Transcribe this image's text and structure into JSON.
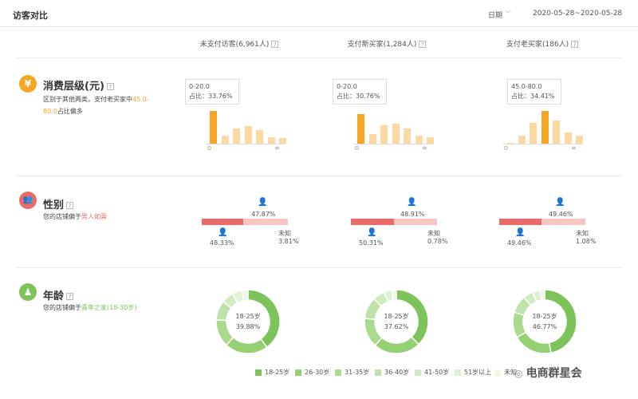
{
  "header": {
    "title": "访客对比",
    "date_label": "日期",
    "date_range": "2020-05-28~2020-05-28"
  },
  "columns": [
    {
      "label": "未支付访客(6,961人)"
    },
    {
      "label": "支付新买家(1,284人)"
    },
    {
      "label": "支付老买家(186人)"
    }
  ],
  "help_icon_text": "?",
  "sections": {
    "spend": {
      "icon": "¥",
      "title": "消费层级(元)",
      "desc_prefix": "区别于其他两类，支付老买家中",
      "desc_highlight_a": "45.0",
      "desc_highlight_b": "80.0",
      "desc_suffix": "占比偏多",
      "color_active": "#f5a623",
      "color_light": "#fbd9a0"
    },
    "gender": {
      "icon": "👥",
      "title": "性别",
      "desc_prefix": "您的店铺偏于",
      "desc_highlight": "男人如膏",
      "unknown_label": "未知"
    },
    "age": {
      "icon": "♟",
      "title": "年龄",
      "desc_prefix": "您的店铺偏于",
      "desc_highlight": "青年之家(18-30岁)"
    }
  },
  "spend_charts": [
    {
      "tooltip_range": "0-20.0",
      "tooltip_share": "占比：33.76%",
      "values": [
        33.76,
        8,
        16,
        18,
        14,
        7,
        6
      ],
      "highlight": 0
    },
    {
      "tooltip_range": "0-20.0",
      "tooltip_share": "占比：30.76%",
      "values": [
        30.76,
        10,
        19,
        21,
        16,
        8,
        7
      ],
      "highlight": 0
    },
    {
      "tooltip_range": "45.0-80.0",
      "tooltip_share": "占比：34.41%",
      "values": [
        1,
        8,
        22,
        34.41,
        24,
        12,
        8
      ],
      "highlight": 3
    }
  ],
  "gender": [
    {
      "female_pct": "47.87%",
      "male_pct": "48.33%",
      "unknown_pct": "3.81%",
      "male": 48.33,
      "female": 47.87
    },
    {
      "female_pct": "48.91%",
      "male_pct": "50.31%",
      "unknown_pct": "0.78%",
      "male": 50.31,
      "female": 48.91
    },
    {
      "female_pct": "49.46%",
      "male_pct": "49.46%",
      "unknown_pct": "1.08%",
      "male": 49.46,
      "female": 49.46
    }
  ],
  "age": [
    {
      "center_label": "18-25岁",
      "center_value": "39.88%",
      "values": [
        39.88,
        22,
        14,
        10,
        6,
        5,
        3.12
      ]
    },
    {
      "center_label": "18-25岁",
      "center_value": "37.62%",
      "values": [
        37.62,
        24,
        15,
        11,
        6,
        4,
        2.38
      ]
    },
    {
      "center_label": "18-25岁",
      "center_value": "46.77%",
      "values": [
        46.77,
        20,
        13,
        9,
        5,
        4,
        2.23
      ]
    }
  ],
  "age_legend": [
    {
      "label": "18-25岁",
      "color": "#7cc45a"
    },
    {
      "label": "26-30岁",
      "color": "#93d072"
    },
    {
      "label": "31-35岁",
      "color": "#a9da8e"
    },
    {
      "label": "36-40岁",
      "color": "#bde3a8"
    },
    {
      "label": "41-50岁",
      "color": "#cfebc0"
    },
    {
      "label": "51岁以上",
      "color": "#e0f2d6"
    },
    {
      "label": "未知",
      "color": "#eef7e8"
    }
  ],
  "age_colors": [
    "#7cc45a",
    "#93d072",
    "#a9da8e",
    "#bde3a8",
    "#cfebc0",
    "#e0f2d6",
    "#eef7e8"
  ],
  "watermark": "电商群星会"
}
